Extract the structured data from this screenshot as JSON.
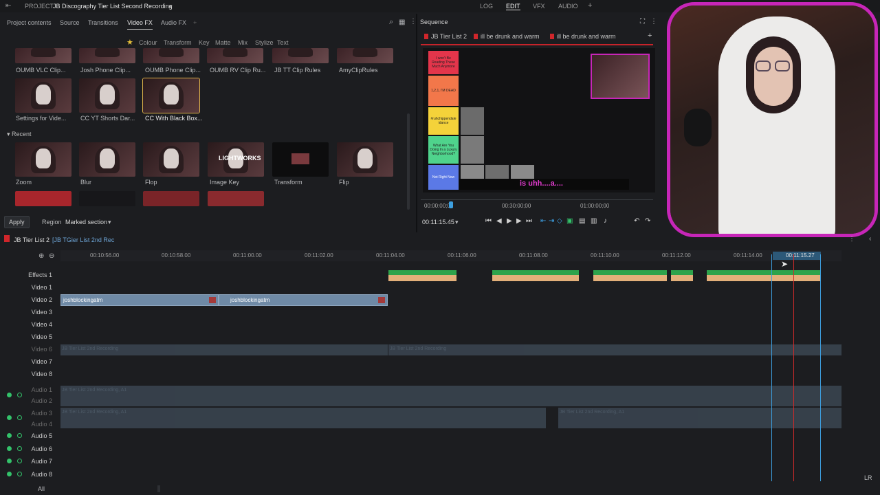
{
  "topbar": {
    "project_label": "PROJECT",
    "project_name": "JB Discography Tier List Second Recording",
    "modes": [
      "LOG",
      "EDIT",
      "VFX",
      "AUDIO"
    ],
    "add": "+"
  },
  "left_tabs": [
    "Project contents",
    "Source",
    "Transitions",
    "Video FX",
    "Audio FX"
  ],
  "fx_categories": [
    "Colour",
    "Transform",
    "Key",
    "Matte",
    "Mix",
    "Stylize",
    "Text"
  ],
  "favorites": [
    {
      "label": "OUMB VLC Clip..."
    },
    {
      "label": "Josh Phone Clip..."
    },
    {
      "label": "OUMB Phone Clip..."
    },
    {
      "label": "OUMB RV Clip Ru..."
    },
    {
      "label": "JB TT Clip Rules"
    },
    {
      "label": "AmyClipRules"
    },
    {
      "label": "Settings for Vide..."
    },
    {
      "label": "CC YT Shorts Dar..."
    },
    {
      "label": "CC With Black Box..."
    }
  ],
  "recent_header": "Recent",
  "recent": [
    {
      "label": "Zoom"
    },
    {
      "label": "Blur"
    },
    {
      "label": "Flop"
    },
    {
      "label": "Image Key",
      "overlay": "LIGHTWORKS"
    },
    {
      "label": "Transform"
    },
    {
      "label": "Flip"
    }
  ],
  "apply_button": "Apply",
  "region_label": "Region",
  "region_value": "Marked section",
  "sequence": {
    "title": "Sequence",
    "tabs": [
      "JB Tier List 2",
      "ill be drunk and warm",
      "ill be drunk and warm"
    ],
    "tier_rows": [
      {
        "text": "I won't Be Reading These Much Anymore",
        "color": "#e3354b"
      },
      {
        "text": "1,2,1, I'M DEAD",
        "color": "#f2774a"
      },
      {
        "text": "#ruhchippendale idance",
        "color": "#f4d23a"
      },
      {
        "text": "What Are You Doing In a Luxury Neighborhood?",
        "color": "#4fd38c"
      },
      {
        "text": "Not Right Now",
        "color": "#5b79e6"
      }
    ],
    "caption": "is uhh....a....",
    "ruler": [
      "00:00:00;00",
      "00:30:00;00",
      "01:00:00;00"
    ],
    "timecode": "00:11:15.45"
  },
  "timeline": {
    "name": "JB Tier List 2",
    "source_name": "[JB TGier List 2nd Rec",
    "ticks": [
      "00:10:56.00",
      "00:10:58.00",
      "00:11:00.00",
      "00:11:02.00",
      "00:11:04.00",
      "00:11:06.00",
      "00:11:08.00",
      "00:11:10.00",
      "00:11:12.00",
      "00:11:14.00"
    ],
    "playhead_tc": "00:11:15.27",
    "tracks": [
      "Effects 1",
      "Video 1",
      "Video 2",
      "Video 3",
      "Video 4",
      "Video 5",
      "Video 6",
      "Video 7",
      "Video 8",
      "Audio 1",
      "Audio 2",
      "Audio 3",
      "Audio 4",
      "Audio 5",
      "Audio 6",
      "Audio 7",
      "Audio 8"
    ],
    "video2_clips": [
      "joshblockingatm",
      "joshblockingatm"
    ],
    "ghost_label": "JB Tier List 2nd Recording",
    "ghost_audio_label": "JB Tier List 2nd Recording, A1",
    "all_label": "All",
    "lr_label": "LR"
  }
}
